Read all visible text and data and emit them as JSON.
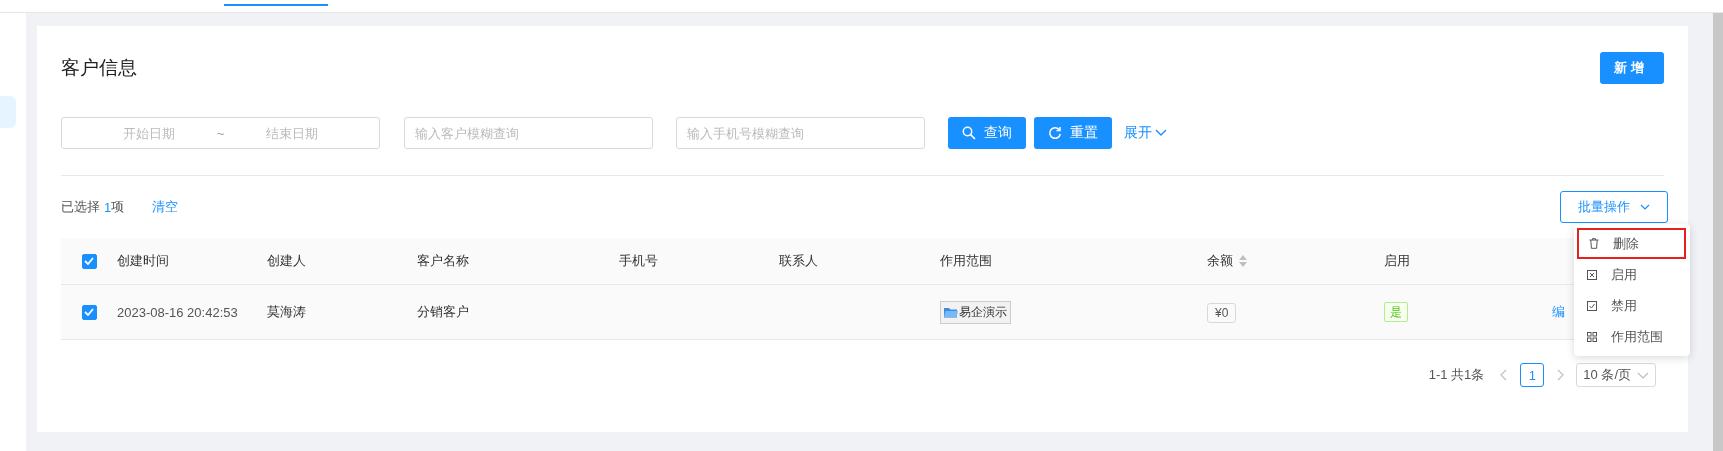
{
  "page": {
    "title": "客户信息",
    "add_button": "新增"
  },
  "filters": {
    "date_range": {
      "start_placeholder": "开始日期",
      "separator": "~",
      "end_placeholder": "结束日期"
    },
    "customer_field": {
      "placeholder": "输入客户模糊查询"
    },
    "phone_field": {
      "placeholder": "输入手机号模糊查询"
    },
    "query_button": "查询",
    "reset_button": "重置",
    "expand_link": "展开"
  },
  "selection": {
    "prefix": "已选择",
    "count": "1",
    "suffix": "项",
    "clear_link": "清空"
  },
  "batch_button": "批量操作",
  "table": {
    "all_checked": true,
    "columns": [
      {
        "label": "创建时间"
      },
      {
        "label": "创建人"
      },
      {
        "label": "客户名称"
      },
      {
        "label": "手机号"
      },
      {
        "label": "联系人"
      },
      {
        "label": "作用范围"
      },
      {
        "label": "余额",
        "sortable": true
      },
      {
        "label": "启用"
      }
    ],
    "rows": [
      {
        "selected": true,
        "created_time": "2023-08-16 20:42:53",
        "creator": "莫海涛",
        "customer_name": "分销客户",
        "scope": "易企演示",
        "balance": "¥0",
        "enabled": "是",
        "action": "编"
      }
    ]
  },
  "batch_menu": [
    {
      "kind": "trash",
      "label": "删除",
      "highlighted": true
    },
    {
      "kind": "cross",
      "label": "启用",
      "highlighted": false
    },
    {
      "kind": "check",
      "label": "禁用",
      "highlighted": false
    },
    {
      "kind": "grid",
      "label": "作用范围",
      "highlighted": false
    }
  ],
  "pagination": {
    "summary": "1-1 共1条",
    "pages": [
      {
        "label": "1",
        "selected": true
      }
    ],
    "page_size": "10 条/页"
  }
}
